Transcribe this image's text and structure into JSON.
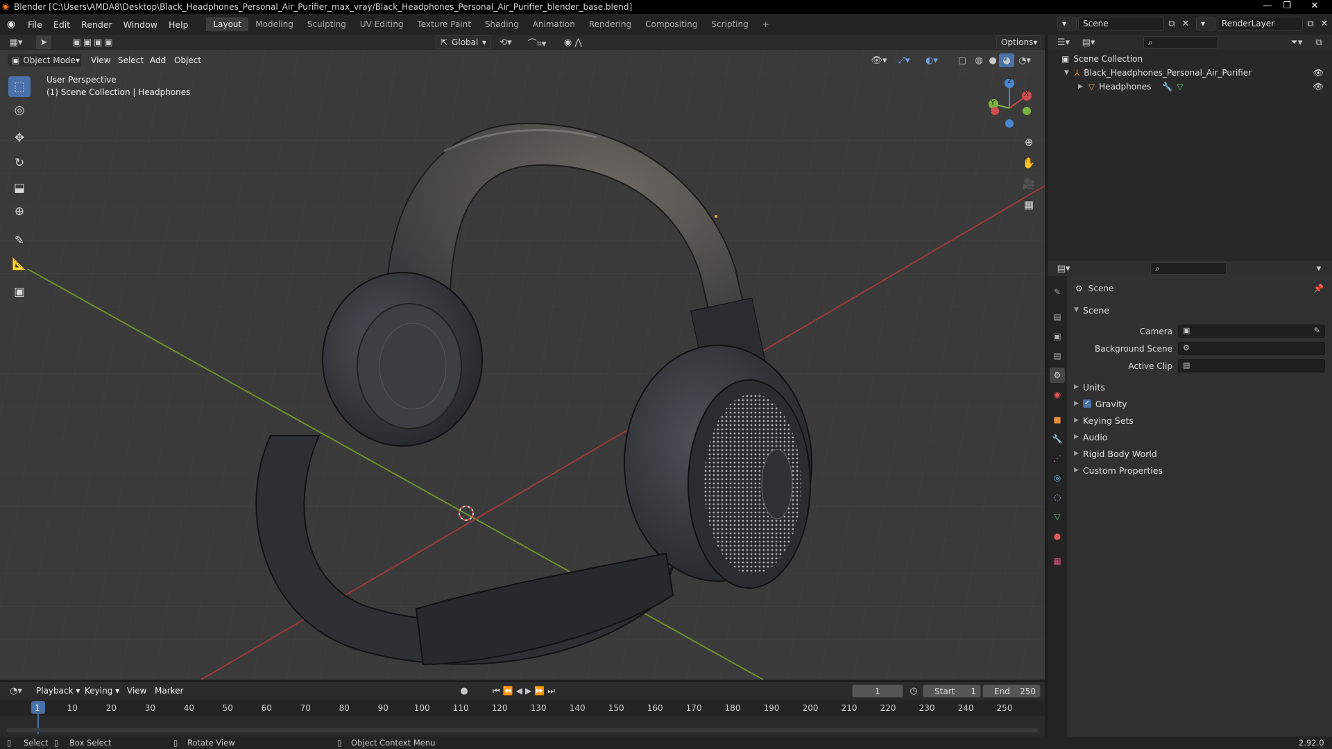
{
  "titlebar": {
    "title": "Blender [C:\\Users\\AMDA8\\Desktop\\Black_Headphones_Personal_Air_Purifier_max_vray/Black_Headphones_Personal_Air_Purifier_blender_base.blend]"
  },
  "menu": {
    "items": [
      "File",
      "Edit",
      "Render",
      "Window",
      "Help"
    ]
  },
  "workspaces": {
    "tabs": [
      "Layout",
      "Modeling",
      "Sculpting",
      "UV Editing",
      "Texture Paint",
      "Shading",
      "Animation",
      "Rendering",
      "Compositing",
      "Scripting"
    ],
    "active": "Layout",
    "add": "+"
  },
  "top_right": {
    "scene_name": "Scene",
    "view_layer": "RenderLayer"
  },
  "viewport_header": {
    "transform_orientation": "Global",
    "options_label": "Options",
    "mode": "Object Mode",
    "menus": [
      "View",
      "Select",
      "Add",
      "Object"
    ]
  },
  "viewport": {
    "perspective_label": "User Perspective",
    "collection_label": "(1) Scene Collection | Headphones",
    "gizmo": {
      "x": "X",
      "y": "Y",
      "z": "Z"
    }
  },
  "tools": [
    {
      "name": "select-box-tool",
      "glyph": "⬚"
    },
    {
      "name": "cursor-tool",
      "glyph": "◎"
    },
    {
      "name": "move-tool",
      "glyph": "✥"
    },
    {
      "name": "rotate-tool",
      "glyph": "↻"
    },
    {
      "name": "scale-tool",
      "glyph": "⬓"
    },
    {
      "name": "transform-tool",
      "glyph": "⊕"
    },
    {
      "name": "annotate-tool",
      "glyph": "✎"
    },
    {
      "name": "measure-tool",
      "glyph": "📐"
    },
    {
      "name": "add-cube-tool",
      "glyph": "▣"
    }
  ],
  "outliner": {
    "root": "Scene Collection",
    "collection": "Black_Headphones_Personal_Air_Purifier",
    "object": "Headphones"
  },
  "properties": {
    "context_title": "Scene",
    "panel_title": "Scene",
    "fields": [
      {
        "label": "Camera",
        "value": ""
      },
      {
        "label": "Background Scene",
        "value": ""
      },
      {
        "label": "Active Clip",
        "value": ""
      }
    ],
    "subpanels": [
      {
        "label": "Units",
        "checkbox": false
      },
      {
        "label": "Gravity",
        "checkbox": true
      },
      {
        "label": "Keying Sets",
        "checkbox": false
      },
      {
        "label": "Audio",
        "checkbox": false
      },
      {
        "label": "Rigid Body World",
        "checkbox": false
      },
      {
        "label": "Custom Properties",
        "checkbox": false
      }
    ],
    "tab_colors": [
      "#a8a8a8",
      "#a8a8a8",
      "#a8a8a8",
      "#a8a8a8",
      "#cfcfcf",
      "#e45858",
      "#e8913a",
      "#6fa0e0",
      "#c66bd0",
      "#5fb0e0",
      "#8fb0e0",
      "#5fc27a",
      "#e05a5a",
      "#e0507a"
    ]
  },
  "timeline": {
    "menus": [
      "Playback",
      "Keying",
      "View",
      "Marker"
    ],
    "current_frame": "1",
    "start_label": "Start",
    "start_value": "1",
    "end_label": "End",
    "end_value": "250",
    "ruler": [
      "1",
      "10",
      "20",
      "30",
      "40",
      "50",
      "60",
      "70",
      "80",
      "90",
      "100",
      "110",
      "120",
      "130",
      "140",
      "150",
      "160",
      "170",
      "180",
      "190",
      "200",
      "210",
      "220",
      "230",
      "240",
      "250"
    ]
  },
  "statusbar": {
    "select": "Select",
    "box_select": "Box Select",
    "rotate_view": "Rotate View",
    "context_menu": "Object Context Menu",
    "version": "2.92.0"
  }
}
